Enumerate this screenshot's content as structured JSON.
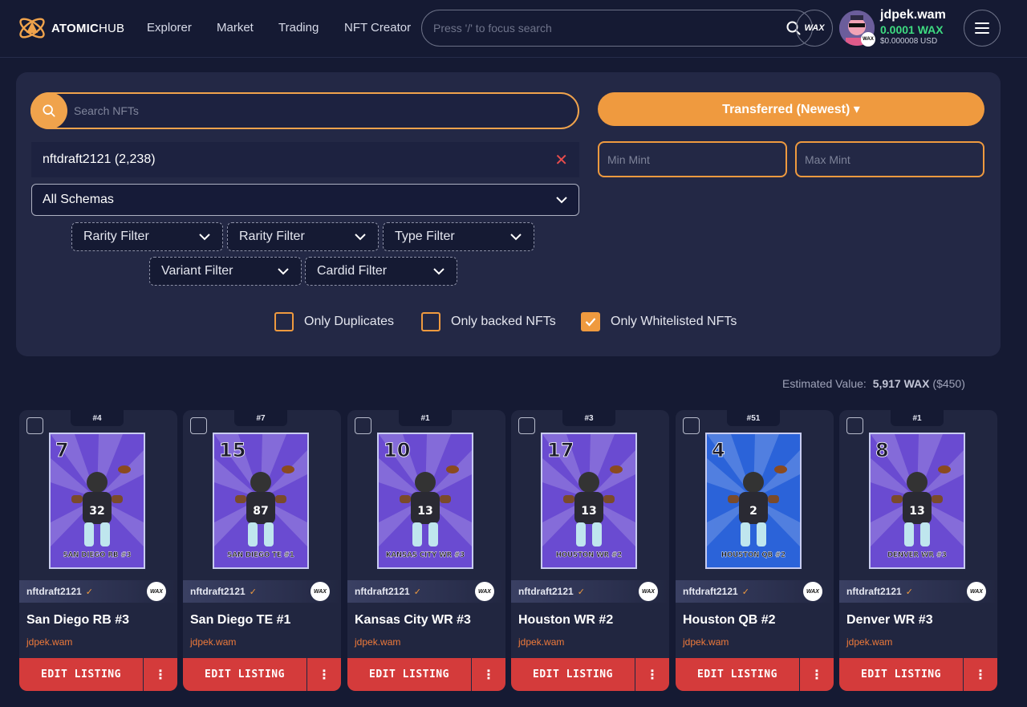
{
  "header": {
    "logo_text_bold": "ATOMIC",
    "logo_text_light": "HUB",
    "nav": [
      "Explorer",
      "Market",
      "Trading",
      "NFT Creator"
    ],
    "search_placeholder": "Press '/' to focus search",
    "wax_label": "WAX",
    "user": {
      "name": "jdpek.wam",
      "balance": "0.0001 WAX",
      "usd": "$0.000008 USD"
    }
  },
  "filters": {
    "search_placeholder": "Search NFTs",
    "sort_label": "Transferred (Newest) ▾",
    "collection": "nftdraft2121 (2,238)",
    "min_mint_placeholder": "Min Mint",
    "max_mint_placeholder": "Max Mint",
    "schema_select": "All Schemas",
    "dropdowns": [
      "Rarity Filter",
      "Rarity Filter",
      "Type Filter",
      "Variant Filter",
      "Cardid Filter"
    ],
    "checks": [
      {
        "label": "Only Duplicates",
        "checked": false
      },
      {
        "label": "Only backed NFTs",
        "checked": false
      },
      {
        "label": "Only Whitelisted NFTs",
        "checked": true
      }
    ]
  },
  "estimated": {
    "label": "Estimated Value:",
    "wax": "5,917 WAX",
    "usd": "($450)"
  },
  "colors": {
    "accent": "#ef9a3f",
    "danger": "#d43b3b",
    "success": "#3edc81",
    "bg": "#151a33",
    "panel": "#232845"
  },
  "cards": [
    {
      "mint": "#4",
      "jersey": "7",
      "caption": "SAN DIEGO RB #3",
      "collection": "nftdraft2121",
      "name": "San Diego RB #3",
      "owner": "jdpek.wam",
      "edit": "EDIT LISTING",
      "bg": "#6a4bd1",
      "player": "32"
    },
    {
      "mint": "#7",
      "jersey": "15",
      "caption": "SAN DIEGO TE #1",
      "collection": "nftdraft2121",
      "name": "San Diego TE #1",
      "owner": "jdpek.wam",
      "edit": "EDIT LISTING",
      "bg": "#6a4bd1",
      "player": "87"
    },
    {
      "mint": "#1",
      "jersey": "10",
      "caption": "KANSAS CITY WR #3",
      "collection": "nftdraft2121",
      "name": "Kansas City WR #3",
      "owner": "jdpek.wam",
      "edit": "EDIT LISTING",
      "bg": "#6a4bd1",
      "player": "13"
    },
    {
      "mint": "#3",
      "jersey": "17",
      "caption": "HOUSTON WR #2",
      "collection": "nftdraft2121",
      "name": "Houston WR #2",
      "owner": "jdpek.wam",
      "edit": "EDIT LISTING",
      "bg": "#6a4bd1",
      "player": "13"
    },
    {
      "mint": "#51",
      "jersey": "4",
      "caption": "HOUSTON QB #2",
      "collection": "nftdraft2121",
      "name": "Houston QB #2",
      "owner": "jdpek.wam",
      "edit": "EDIT LISTING",
      "bg": "#2b63d9",
      "player": "2"
    },
    {
      "mint": "#1",
      "jersey": "8",
      "caption": "DENVER WR #3",
      "collection": "nftdraft2121",
      "name": "Denver WR #3",
      "owner": "jdpek.wam",
      "edit": "EDIT LISTING",
      "bg": "#6a4bd1",
      "player": "13"
    }
  ]
}
